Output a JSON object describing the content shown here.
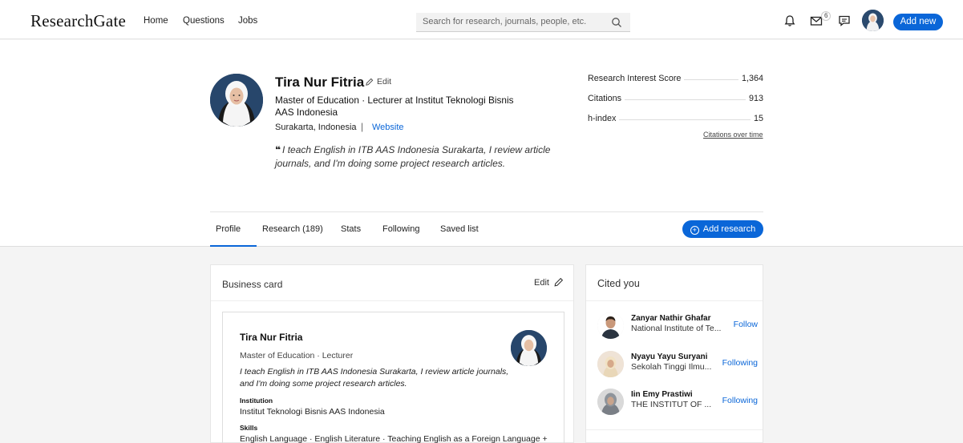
{
  "nav": {
    "logo": "ResearchGate",
    "links": [
      "Home",
      "Questions",
      "Jobs"
    ],
    "search_placeholder": "Search for research, journals, people, etc.",
    "messages_badge": "6",
    "add_new": "Add new"
  },
  "profile": {
    "name": "Tira Nur Fitria",
    "edit": "Edit",
    "headline": "Master of Education · Lecturer at Institut Teknologi Bisnis AAS Indonesia",
    "location": "Surakarta, Indonesia",
    "website": "Website",
    "bio": "I teach English in ITB AAS Indonesia Surakarta, I review article journals, and I'm doing some project research articles."
  },
  "stats": [
    {
      "label": "Research Interest Score",
      "value": "1,364"
    },
    {
      "label": "Citations",
      "value": "913"
    },
    {
      "label": "h-index",
      "value": "15"
    }
  ],
  "citations_over_time": "Citations over time",
  "tabs": [
    "Profile",
    "Research (189)",
    "Stats",
    "Following",
    "Saved list"
  ],
  "add_research": "Add research",
  "business_card": {
    "title": "Business card",
    "edit": "Edit",
    "name": "Tira Nur Fitria",
    "position": "Master of Education · Lecturer",
    "bio": "I teach English in ITB AAS Indonesia Surakarta, I review article journals, and I'm doing some project research articles.",
    "institution_label": "Institution",
    "institution": "Institut Teknologi Bisnis AAS Indonesia",
    "skills_label": "Skills",
    "skills": "English Language · English Literature · Teaching English as a Foreign Language +"
  },
  "cited_you": {
    "title": "Cited you",
    "people": [
      {
        "name": "Zanyar Nathir Ghafar",
        "institution": "National Institute of Te...",
        "action": "Follow"
      },
      {
        "name": "Nyayu Yayu Suryani",
        "institution": "Sekolah Tinggi Ilmu...",
        "action": "Following"
      },
      {
        "name": "Iin Emy Prastiwi",
        "institution": "THE INSTITUT OF ...",
        "action": "Following"
      }
    ]
  },
  "colors": {
    "accent": "#0a66d8",
    "background": "#f4f4f4"
  }
}
